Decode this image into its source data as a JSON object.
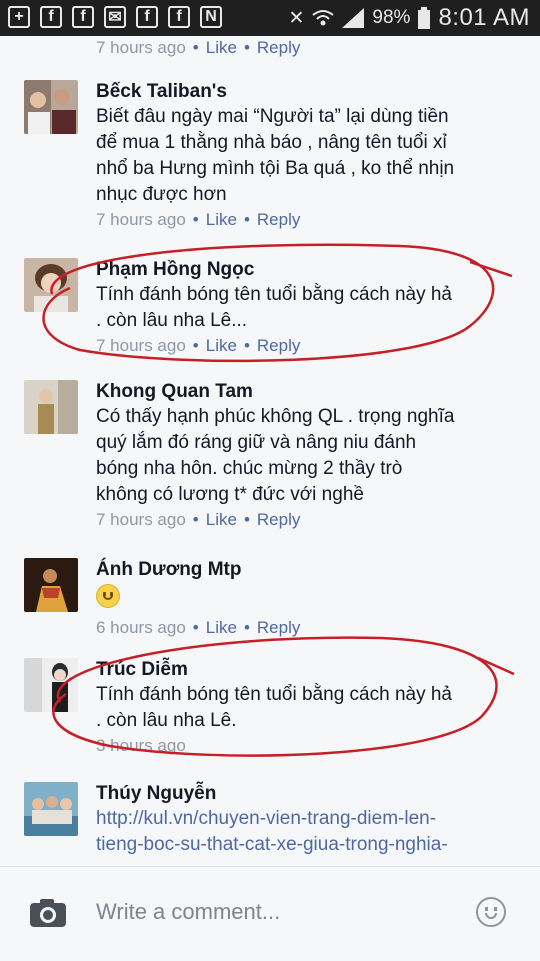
{
  "status_bar": {
    "battery": "98%",
    "time": "8:01 AM",
    "icons": [
      "add-box-icon",
      "facebook-icon",
      "facebook-icon",
      "mail-icon",
      "facebook-icon",
      "facebook-icon",
      "nfc-icon",
      "mute-icon",
      "wifi-icon",
      "signal-icon",
      "battery-icon"
    ]
  },
  "actions": {
    "like": "Like",
    "reply": "Reply"
  },
  "top_meta": {
    "time": "7 hours ago"
  },
  "comments": [
    {
      "name": "Bếck Taliban's",
      "text": "Biết đâu ngày mai “Người ta” lại dùng tiền\nđể mua 1 thằng nhà báo , nâng tên tuổi xỉ\nnhổ ba Hưng mình tội Ba quá , ko thể nhịn\nnhục được hơn",
      "time": "7 hours ago"
    },
    {
      "name": "Phạm Hồng Ngọc",
      "text": "Tính đánh bóng tên tuổi bằng cách này hả\n. còn lâu nha Lê...",
      "time": "7 hours ago"
    },
    {
      "name": "Khong Quan Tam",
      "text": "Có thấy hạnh phúc không QL . trọng nghĩa\nquý lắm đó ráng giữ và nâng niu đánh\nbóng nha hôn. chúc mừng 2 thầy trò\nkhông có lương t* đức với nghề",
      "time": "7 hours ago"
    },
    {
      "name": "Ánh Dương Mtp",
      "text": "",
      "time": "6 hours ago"
    },
    {
      "name": "Trúc Diễm",
      "text": "Tính đánh bóng tên tuổi bằng cách này hả\n. còn lâu nha Lê.",
      "time": "3 hours ago"
    },
    {
      "name": "Thúy Nguyễn",
      "text": "http://kul.vn/chuyen-vien-trang-diem-len-\ntieng-boc-su-that-cat-xe-giua-trong-nghia-",
      "time": ""
    }
  ],
  "composer": {
    "placeholder": "Write a comment..."
  },
  "colors": {
    "link": "#4e69a2",
    "annotation": "#c81e25",
    "statusbar": "#1f1f1f"
  }
}
